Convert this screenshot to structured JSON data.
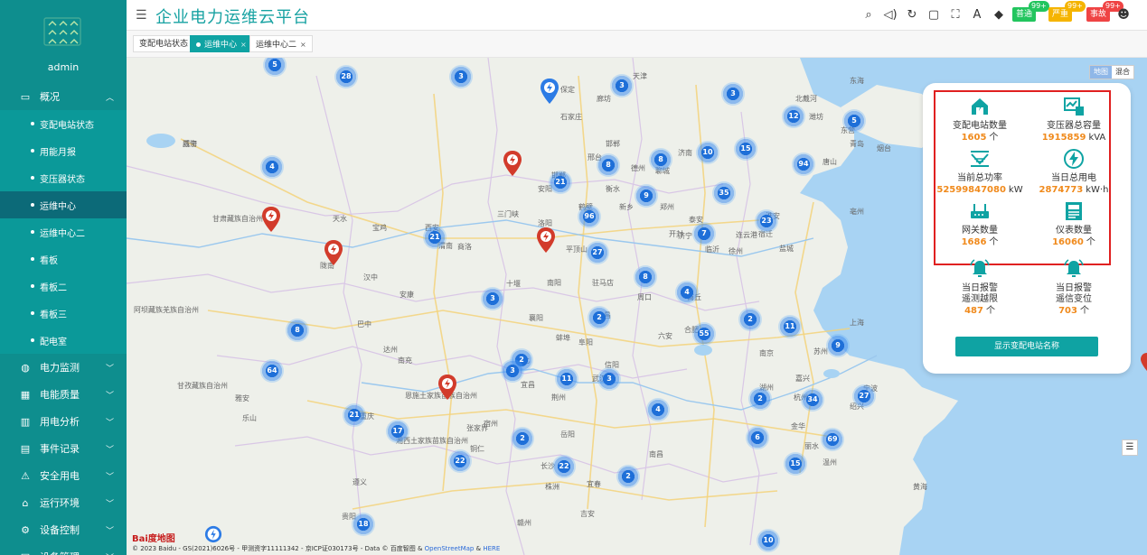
{
  "header": {
    "title": "企业电力运维云平台",
    "badges": [
      {
        "label": "普通",
        "count": "99+",
        "color": "#22c55e"
      },
      {
        "label": "严重",
        "count": "99+",
        "color": "#f5b400"
      },
      {
        "label": "事故",
        "count": "99+",
        "color": "#ef4444"
      }
    ],
    "icons": [
      "search-icon",
      "volume-icon",
      "refresh-icon",
      "save-icon",
      "fullscreen-icon",
      "font-icon",
      "skin-icon"
    ]
  },
  "sidebar": {
    "username": "admin",
    "menu": [
      {
        "label": "概况",
        "icon": "monitor-icon",
        "expanded": true
      },
      {
        "label": "电力监测",
        "icon": "globe-icon"
      },
      {
        "label": "电能质量",
        "icon": "bar-chart-icon"
      },
      {
        "label": "用电分析",
        "icon": "analysis-icon"
      },
      {
        "label": "事件记录",
        "icon": "document-icon"
      },
      {
        "label": "安全用电",
        "icon": "safety-icon"
      },
      {
        "label": "运行环境",
        "icon": "environment-icon"
      },
      {
        "label": "设备控制",
        "icon": "control-icon"
      },
      {
        "label": "设备管理",
        "icon": "device-icon"
      }
    ],
    "submenu": [
      {
        "label": "变配电站状态"
      },
      {
        "label": "用能月报"
      },
      {
        "label": "变压器状态"
      },
      {
        "label": "运维中心",
        "active": true
      },
      {
        "label": "运维中心二"
      },
      {
        "label": "看板"
      },
      {
        "label": "看板二"
      },
      {
        "label": "看板三"
      },
      {
        "label": "配电室"
      }
    ]
  },
  "tabs": [
    {
      "label": "变配电站状态",
      "active": false,
      "closable": false
    },
    {
      "label": "运维中心",
      "active": true,
      "closable": true
    },
    {
      "label": "运维中心二",
      "active": false,
      "closable": true
    }
  ],
  "map": {
    "type_options": [
      "地图",
      "混合"
    ],
    "copyright": "© 2023 Baidu - GS(2021)6026号 - 甲测资字11111342 - 京ICP证030173号 - Data © 百度智图 & ",
    "copyright_links": [
      "OpenStreetMap",
      "HERE"
    ],
    "baidu_logo": "Bai度地图",
    "labels": [
      "西宁",
      "甘肃藏族自治州",
      "天水",
      "西安",
      "渭南",
      "商洛",
      "洛阳",
      "平顶山",
      "三门峡",
      "宝鸡",
      "陇南",
      "汉中",
      "安康",
      "阿坝藏族羌族自治州",
      "巴中",
      "达州",
      "南充",
      "甘孜藏族自治州",
      "雅安",
      "乐山",
      "重庆",
      "恩施土家族苗族自治州",
      "湘西土家族苗族自治州",
      "张家界",
      "宜昌",
      "荆州",
      "武汉",
      "襄阳",
      "十堰",
      "南阳",
      "驻马店",
      "信阳",
      "合肥",
      "六安",
      "南京",
      "杭州",
      "宁波",
      "绍兴",
      "金华",
      "丽水",
      "温州",
      "南昌",
      "长沙",
      "株洲",
      "岳阳",
      "宜春",
      "吉安",
      "赣州",
      "贵阳",
      "遵义",
      "铜仁",
      "泰安",
      "济宁",
      "临沂",
      "徐州",
      "连云港",
      "宿迁",
      "淮安",
      "盐城",
      "上海",
      "苏州",
      "嘉兴",
      "湖州",
      "德州",
      "济南",
      "聊城",
      "邯郸",
      "邢台",
      "石家庄",
      "衡水",
      "保定",
      "天津",
      "廊坊",
      "邯郸",
      "安阳",
      "鹤壁",
      "新乡",
      "郑州",
      "开封",
      "商丘",
      "周口",
      "许昌",
      "阜阳",
      "蚌埠",
      "淮北",
      "宿州",
      "亳州",
      "黄海",
      "东海",
      "北戴河",
      "唐山",
      "东营",
      "潍坊",
      "青岛",
      "烟台",
      "威海"
    ],
    "clusters": [
      {
        "n": "5"
      },
      {
        "n": "28"
      },
      {
        "n": "3"
      },
      {
        "n": "3"
      },
      {
        "n": "3"
      },
      {
        "n": "12"
      },
      {
        "n": "5"
      },
      {
        "n": "4"
      },
      {
        "n": "10"
      },
      {
        "n": "15"
      },
      {
        "n": "8"
      },
      {
        "n": "8"
      },
      {
        "n": "94"
      },
      {
        "n": "21"
      },
      {
        "n": "9"
      },
      {
        "n": "35"
      },
      {
        "n": "96"
      },
      {
        "n": "21"
      },
      {
        "n": "27"
      },
      {
        "n": "7"
      },
      {
        "n": "23"
      },
      {
        "n": "8"
      },
      {
        "n": "3"
      },
      {
        "n": "4"
      },
      {
        "n": "8"
      },
      {
        "n": "2"
      },
      {
        "n": "11"
      },
      {
        "n": "55"
      },
      {
        "n": "9"
      },
      {
        "n": "64"
      },
      {
        "n": "2"
      },
      {
        "n": "2"
      },
      {
        "n": "3"
      },
      {
        "n": "11"
      },
      {
        "n": "3"
      },
      {
        "n": "2"
      },
      {
        "n": "34"
      },
      {
        "n": "27"
      },
      {
        "n": "21"
      },
      {
        "n": "17"
      },
      {
        "n": "4"
      },
      {
        "n": "2"
      },
      {
        "n": "6"
      },
      {
        "n": "69"
      },
      {
        "n": "22"
      },
      {
        "n": "22"
      },
      {
        "n": "2"
      },
      {
        "n": "15"
      },
      {
        "n": "18"
      },
      {
        "n": "10"
      }
    ]
  },
  "panel": {
    "stats": [
      {
        "label": "变配电站数量",
        "value": "1605",
        "unit": "个",
        "icon": "substation-icon"
      },
      {
        "label": "变压器总容量",
        "value": "1915859",
        "unit": "kVA",
        "icon": "transformer-icon"
      },
      {
        "label": "当前总功率",
        "value": "52599847080",
        "unit": "kW",
        "icon": "power-icon"
      },
      {
        "label": "当日总用电",
        "value": "2874773",
        "unit": "kW·h",
        "icon": "lightning-icon"
      },
      {
        "label": "网关数量",
        "value": "1686",
        "unit": "个",
        "icon": "gateway-icon"
      },
      {
        "label": "仪表数量",
        "value": "16060",
        "unit": "个",
        "icon": "meter-icon"
      },
      {
        "label": "当日报警\n遥测越限",
        "value": "487",
        "unit": "个",
        "icon": "alarm-icon"
      },
      {
        "label": "当日报警\n遥信变位",
        "value": "703",
        "unit": "个",
        "icon": "alarm-icon"
      }
    ],
    "button": "显示变配电站名称"
  },
  "colors": {
    "primary": "#0fa3a3",
    "sidebar": "#0e8e8e",
    "active_sub": "#0c6a78",
    "highlight": "#f08a1c",
    "alert_box": "#e02020"
  }
}
